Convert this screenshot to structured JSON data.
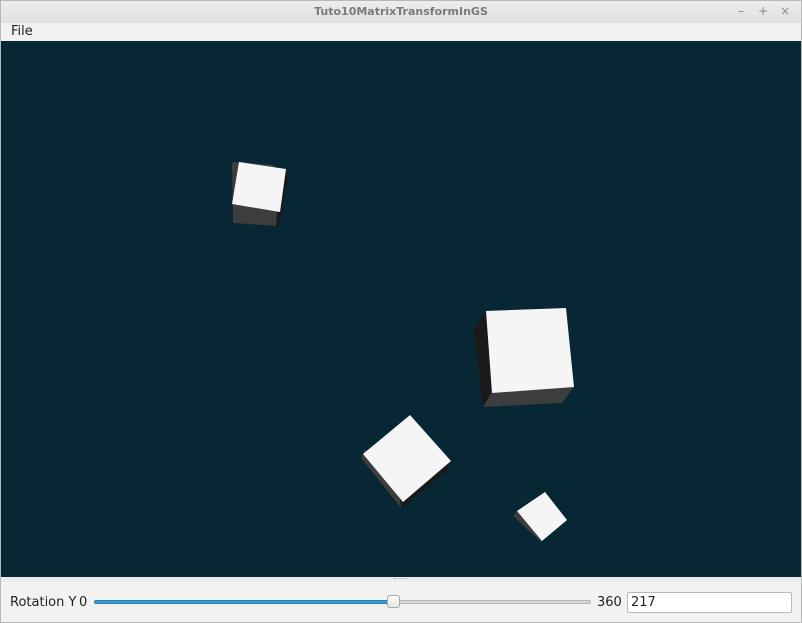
{
  "window": {
    "title": "Tuto10MatrixTransformInGS",
    "minimize_glyph": "–",
    "maximize_glyph": "+",
    "close_glyph": "×"
  },
  "menu": {
    "items": [
      {
        "label": "File"
      }
    ]
  },
  "viewport": {
    "background": "#062733",
    "face_color": "#f5f5f5",
    "shade_color": "#3d3d3d",
    "dark_shade_color": "#1a1a1a"
  },
  "controls": {
    "rotation_label": "Rotation Y",
    "min_label": "0",
    "max_label": "360",
    "min": 0,
    "max": 360,
    "value": 217,
    "value_text": "217",
    "accent": "#3d9ad6"
  }
}
